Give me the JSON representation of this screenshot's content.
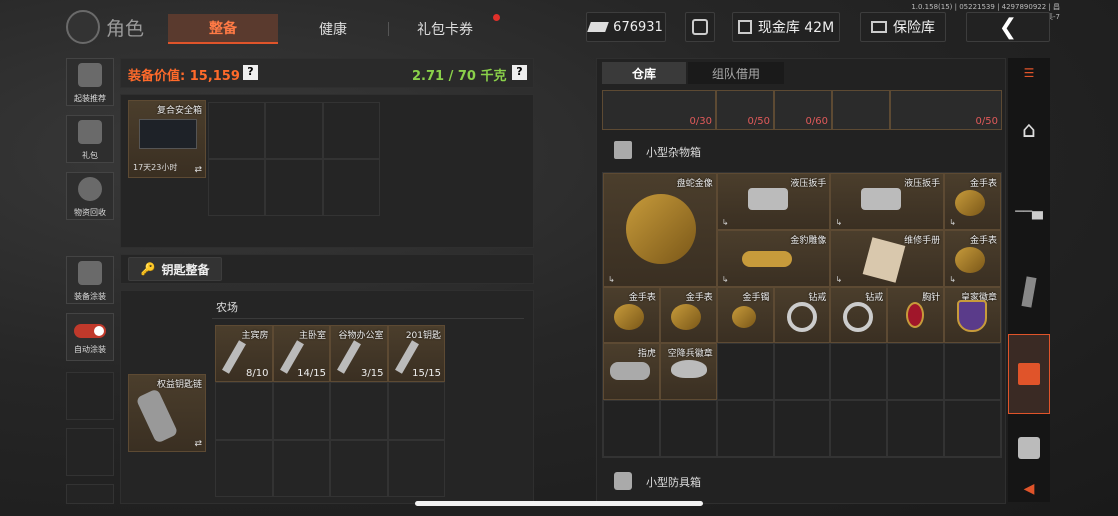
{
  "header": {
    "title": "角色",
    "tabs": [
      {
        "label": "整备"
      },
      {
        "label": "健康"
      },
      {
        "label": "礼包卡券"
      }
    ],
    "currency": "676931",
    "cash_vault": "现金库 42M",
    "safe_vault": "保险库",
    "version": "1.0.158(15) | 05221539 | 4297890922 | 昌集-7"
  },
  "sidebar": {
    "items": [
      {
        "label": "起装推荐"
      },
      {
        "label": "礼包"
      },
      {
        "label": "物资回收"
      },
      {
        "label": "装备涂装"
      },
      {
        "label": "自动涂装"
      }
    ]
  },
  "equip": {
    "value_label": "装备价值: 15,159",
    "weight_value": "2.71",
    "weight_max": "/ 70 千克",
    "help": "?"
  },
  "safe_box": {
    "name": "复合安全箱",
    "timer": "17天23小时"
  },
  "key_section": {
    "title": "钥匙整备",
    "key_chain": "权益钥匙链",
    "location": "农场",
    "keys": [
      {
        "name": "主宾房",
        "count": "8/10"
      },
      {
        "name": "主卧室",
        "count": "14/15"
      },
      {
        "name": "谷物办公室",
        "count": "3/15"
      },
      {
        "name": "201钥匙",
        "count": "15/15"
      }
    ]
  },
  "storage": {
    "tabs": [
      {
        "label": "仓库"
      },
      {
        "label": "组队借用"
      }
    ],
    "top_counts": [
      "0/30",
      "0/50",
      "0/60",
      "0/50"
    ],
    "misc_box": "小型杂物箱",
    "armor_box": "小型防具箱",
    "items": [
      "盘蛇金像",
      "液压扳手",
      "液压扳手",
      "金手表",
      "金豹雕像",
      "维修手册",
      "金手表",
      "金手表",
      "金手表",
      "金手镯",
      "钻戒",
      "钻戒",
      "胸针",
      "皇家徽章",
      "指虎",
      "空降兵徽章"
    ]
  },
  "colors": {
    "accent": "#e0542a",
    "weight": "#8ad14a",
    "value": "#ff6a2a",
    "gold_bg": "#3f3224"
  }
}
